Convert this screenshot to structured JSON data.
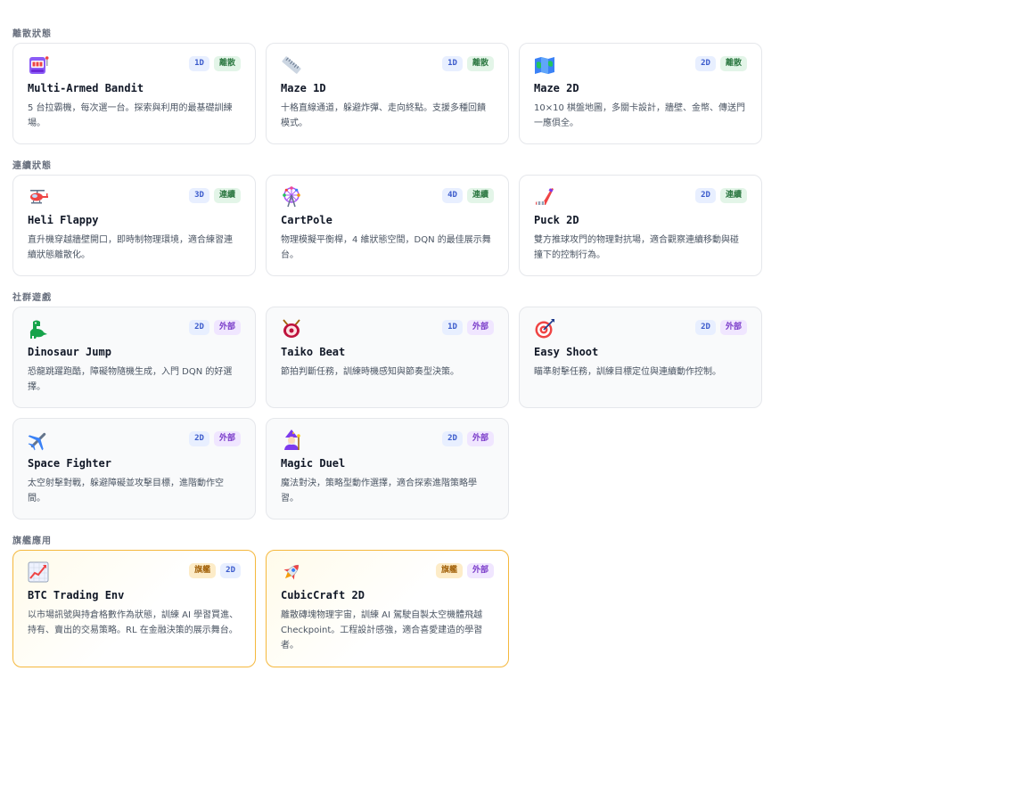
{
  "sections": [
    {
      "title": "離散狀態",
      "cards": [
        {
          "icon": "slot-machine-icon",
          "title": "Multi-Armed Bandit",
          "desc": "5 台拉霸機，每次選一台。探索與利用的最基礎訓練場。",
          "badges": [
            "1D",
            "離散"
          ]
        },
        {
          "icon": "ruler-icon",
          "title": "Maze 1D",
          "desc": "十格直線通道，躲避炸彈、走向終點。支援多種回饋模式。",
          "badges": [
            "1D",
            "離散"
          ]
        },
        {
          "icon": "map-icon",
          "title": "Maze 2D",
          "desc": "10×10 棋盤地圖，多關卡設計，牆壁、金幣、傳送門一應俱全。",
          "badges": [
            "2D",
            "離散"
          ]
        }
      ]
    },
    {
      "title": "連續狀態",
      "cards": [
        {
          "icon": "helicopter-icon",
          "title": "Heli Flappy",
          "desc": "直升機穿越牆壁開口，即時制物理環境，適合練習連續狀態離散化。",
          "badges": [
            "3D",
            "連續"
          ]
        },
        {
          "icon": "ferris-wheel-icon",
          "title": "CartPole",
          "desc": "物理模擬平衡桿，4 維狀態空間，DQN 的最佳展示舞台。",
          "badges": [
            "4D",
            "連續"
          ]
        },
        {
          "icon": "hockey-stick-icon",
          "title": "Puck 2D",
          "desc": "雙方推球攻門的物理對抗場，適合觀察連續移動與碰撞下的控制行為。",
          "badges": [
            "2D",
            "連續"
          ]
        }
      ]
    },
    {
      "title": "社群遊戲",
      "cards": [
        {
          "icon": "dinosaur-icon",
          "title": "Dinosaur Jump",
          "desc": "恐龍跳躍跑酷，障礙物隨機生成，入門 DQN 的好選擇。",
          "badges": [
            "2D",
            "外部"
          ]
        },
        {
          "icon": "taiko-drum-icon",
          "title": "Taiko Beat",
          "desc": "節拍判斷任務，訓練時機感知與節奏型決策。",
          "badges": [
            "1D",
            "外部"
          ]
        },
        {
          "icon": "target-icon",
          "title": "Easy Shoot",
          "desc": "瞄準射擊任務，訓練目標定位與連續動作控制。",
          "badges": [
            "2D",
            "外部"
          ]
        },
        {
          "icon": "airplane-icon",
          "title": "Space Fighter",
          "desc": "太空射擊對戰，躲避障礙並攻擊目標，進階動作空間。",
          "badges": [
            "2D",
            "外部"
          ]
        },
        {
          "icon": "mage-icon",
          "title": "Magic Duel",
          "desc": "魔法對決，策略型動作選擇，適合探索進階策略學習。",
          "badges": [
            "2D",
            "外部"
          ]
        }
      ]
    },
    {
      "title": "旗艦應用",
      "cards": [
        {
          "icon": "chart-up-icon",
          "title": "BTC Trading Env",
          "desc": "以市場訊號與持倉格數作為狀態，訓練 AI 學習買進、持有、賣出的交易策略。RL 在金融決策的展示舞台。",
          "badges": [
            "旗艦",
            "2D"
          ]
        },
        {
          "icon": "rocket-icon",
          "title": "CubicCraft 2D",
          "desc": "離散磚塊物理宇宙，訓練 AI 駕駛自製太空機體飛越 Checkpoint。工程設計感強，適合喜愛建造的學習者。",
          "badges": [
            "旗艦",
            "外部"
          ]
        }
      ]
    }
  ],
  "colors": {
    "flag_border": "#f5b83d",
    "discrete_badge": "#2f7a44",
    "external_badge": "#7a3bc9",
    "dimension_badge": "#3b5bcc"
  }
}
